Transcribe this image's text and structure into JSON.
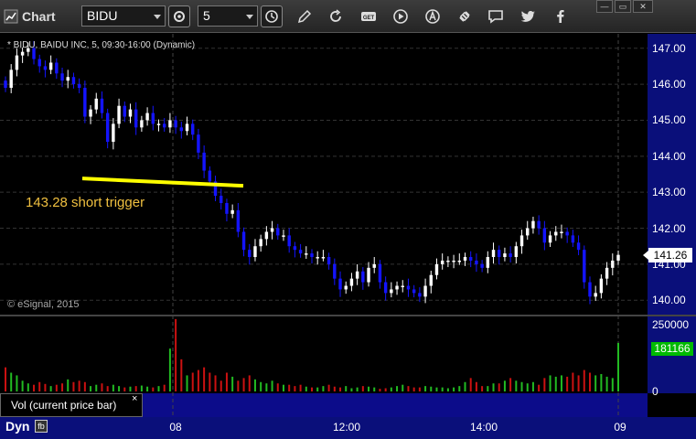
{
  "app": {
    "title": "Chart"
  },
  "toolbar": {
    "symbol": "BIDU",
    "interval": "5",
    "buttons": [
      "settings-icon",
      "clock-icon",
      "pencil-icon",
      "refresh-icon",
      "get-icon",
      "play-icon",
      "alert-icon",
      "link-icon",
      "chat-icon",
      "twitter-icon",
      "facebook-icon"
    ]
  },
  "window_controls": {
    "minimize": "—",
    "restore": "▭",
    "close": "✕"
  },
  "chart_header": "* BIDU, BAIDU INC, 5, 09:30-16:00 (Dynamic)",
  "copyright": "© eSignal, 2015",
  "annotation": {
    "label": "143.28 short trigger",
    "price": 143.28,
    "color": "#ffff00"
  },
  "price_badge": "141.26",
  "volume_badge": "181166",
  "volume_panel_label": "Vol (current price bar)",
  "volume_close": "×",
  "dyn_label": "Dyn",
  "dyn_icon": "fb",
  "colors": {
    "up": "#ffffff",
    "down": "#1414ff",
    "vol_up": "#22bb22",
    "vol_down": "#cc1111",
    "axis": "#0a0f7a",
    "grid": "#333333"
  },
  "chart_data": [
    {
      "type": "candlestick",
      "symbol": "BIDU",
      "interval": "5",
      "ylim": [
        139.6,
        147.4
      ],
      "y_ticks": [
        "147.00",
        "146.00",
        "145.00",
        "144.00",
        "143.00",
        "142.00",
        "141.00",
        "140.00"
      ],
      "x_ticks": [
        "08",
        "12:00",
        "14:00",
        "09"
      ],
      "last_price": 141.26,
      "annotation_line": 143.28,
      "close": [
        145.9,
        146.4,
        146.8,
        146.9,
        147.0,
        146.7,
        146.5,
        146.4,
        146.6,
        146.3,
        146.1,
        146.2,
        146.0,
        145.9,
        145.1,
        145.3,
        145.6,
        145.2,
        144.4,
        144.9,
        145.4,
        145.1,
        145.3,
        144.8,
        145.0,
        145.2,
        144.9,
        144.9,
        144.8,
        145.0,
        144.8,
        144.7,
        144.9,
        144.6,
        144.1,
        143.6,
        143.3,
        142.9,
        142.7,
        142.4,
        142.5,
        141.9,
        141.4,
        141.2,
        141.5,
        141.7,
        141.9,
        142.0,
        141.8,
        141.8,
        141.5,
        141.4,
        141.3,
        141.3,
        141.2,
        141.2,
        141.2,
        141.0,
        140.6,
        140.3,
        140.4,
        140.6,
        140.8,
        140.5,
        140.9,
        141.0,
        140.5,
        140.2,
        140.3,
        140.4,
        140.4,
        140.3,
        140.2,
        140.1,
        140.4,
        140.7,
        141.0,
        141.1,
        141.1,
        141.1,
        141.1,
        141.2,
        141.1,
        141.0,
        140.9,
        141.2,
        141.4,
        141.2,
        141.3,
        141.2,
        141.5,
        141.8,
        142.0,
        142.2,
        142.0,
        141.6,
        141.8,
        141.9,
        141.9,
        141.8,
        141.6,
        141.4,
        140.5,
        140.1,
        140.2,
        140.6,
        140.9,
        141.1,
        141.26
      ]
    },
    {
      "type": "bar",
      "name": "Vol (current price bar)",
      "ylim": [
        0,
        280000
      ],
      "y_ticks": [
        "250000",
        "0"
      ],
      "last_value": 181166,
      "values": [
        90000,
        70000,
        60000,
        40000,
        30000,
        25000,
        35000,
        28000,
        20000,
        25000,
        30000,
        45000,
        35000,
        40000,
        35000,
        20000,
        25000,
        30000,
        20000,
        25000,
        20000,
        15000,
        18000,
        20000,
        22000,
        18000,
        15000,
        20000,
        25000,
        160000,
        270000,
        120000,
        60000,
        70000,
        80000,
        90000,
        70000,
        60000,
        40000,
        70000,
        55000,
        40000,
        50000,
        60000,
        45000,
        35000,
        30000,
        40000,
        30000,
        25000,
        25000,
        20000,
        25000,
        18000,
        15000,
        15000,
        20000,
        25000,
        18000,
        15000,
        20000,
        12000,
        15000,
        20000,
        18000,
        15000,
        10000,
        12000,
        15000,
        20000,
        25000,
        20000,
        15000,
        15000,
        20000,
        18000,
        15000,
        15000,
        12000,
        15000,
        20000,
        35000,
        50000,
        35000,
        20000,
        20000,
        30000,
        30000,
        40000,
        50000,
        40000,
        35000,
        30000,
        35000,
        25000,
        50000,
        60000,
        55000,
        60000,
        55000,
        70000,
        60000,
        80000,
        70000,
        60000,
        65000,
        55000,
        50000,
        181166
      ]
    }
  ]
}
